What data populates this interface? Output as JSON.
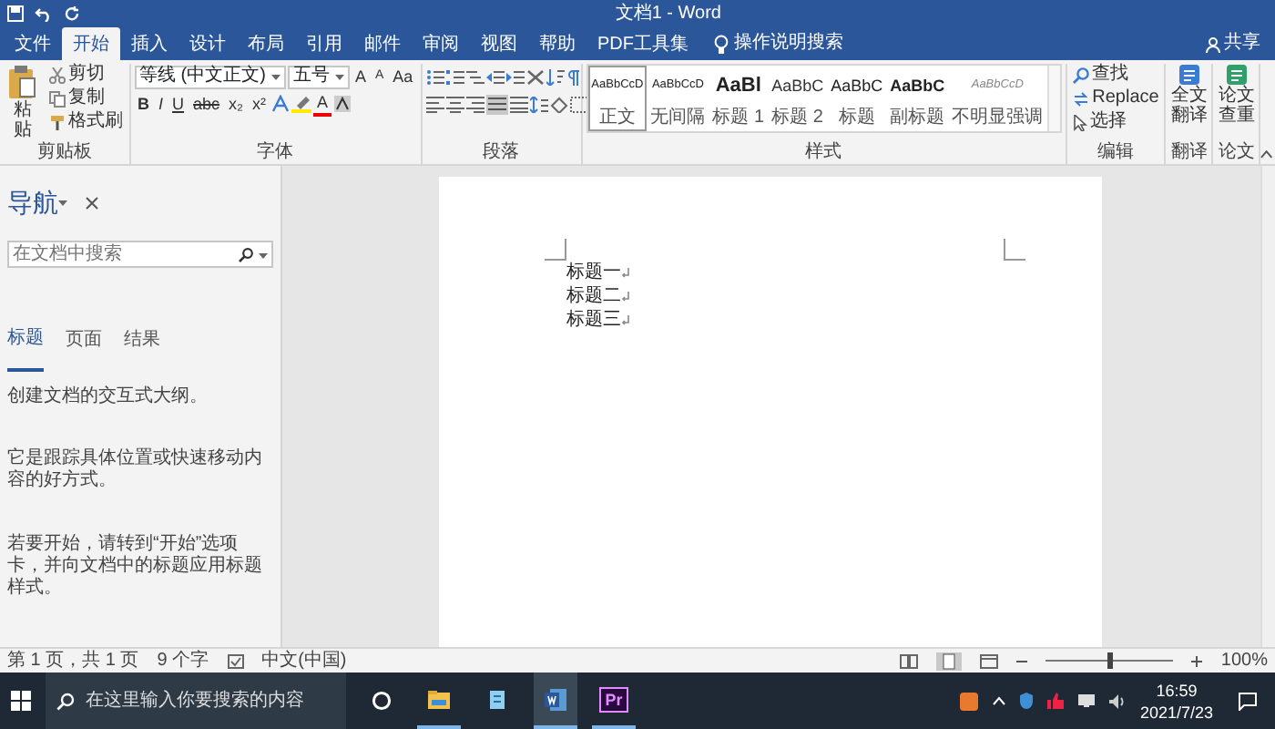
{
  "window": {
    "title": "文档1 - Word"
  },
  "ribbon_tabs": [
    {
      "label": "文件",
      "selected": false
    },
    {
      "label": "开始",
      "selected": true
    },
    {
      "label": "插入",
      "selected": false
    },
    {
      "label": "设计",
      "selected": false
    },
    {
      "label": "布局",
      "selected": false
    },
    {
      "label": "引用",
      "selected": false
    },
    {
      "label": "邮件",
      "selected": false
    },
    {
      "label": "审阅",
      "selected": false
    },
    {
      "label": "视图",
      "selected": false
    },
    {
      "label": "帮助",
      "selected": false
    },
    {
      "label": "PDF工具集",
      "selected": false
    }
  ],
  "tell_me": "操作说明搜索",
  "share": "共享",
  "ribbon": {
    "clipboard": {
      "paste": "粘贴",
      "cut": "剪切",
      "copy": "复制",
      "format_painter": "格式刷",
      "label": "剪贴板"
    },
    "font": {
      "font_name": "等线 (中文正文)",
      "font_size": "五号",
      "size_buttons": [
        "A",
        "A",
        "Aa"
      ],
      "format_buttons": [
        "B",
        "I",
        "U",
        "abc",
        "x₂",
        "x²"
      ],
      "font_color": "A",
      "label": "字体"
    },
    "paragraph": {
      "label": "段落"
    },
    "styles": {
      "items": [
        {
          "sample": "AaBbCcD",
          "name": "正文",
          "kind": "normal",
          "selected": true
        },
        {
          "sample": "AaBbCcD",
          "name": "无间隔",
          "kind": "normal",
          "selected": false
        },
        {
          "sample": "AaBl",
          "name": "标题 1",
          "kind": "heading1",
          "selected": false
        },
        {
          "sample": "AaBbC",
          "name": "标题 2",
          "kind": "heading2",
          "selected": false
        },
        {
          "sample": "AaBbC",
          "name": "标题",
          "kind": "title",
          "selected": false
        },
        {
          "sample": "AaBbC",
          "name": "副标题",
          "kind": "subtitle",
          "selected": false
        },
        {
          "sample": "AaBbCcD",
          "name": "不明显强调",
          "kind": "emphasis",
          "selected": false
        }
      ],
      "label": "样式"
    },
    "editing": {
      "find": "查找",
      "replace": "Replace",
      "select": "选择",
      "label": "编辑"
    },
    "translate": {
      "button": "全文翻译",
      "label": "翻译"
    },
    "plagiarism": {
      "button": "论文查重",
      "label": "论文"
    }
  },
  "navigation": {
    "title": "导航",
    "search_placeholder": "在文档中搜索",
    "tabs": [
      {
        "label": "标题",
        "selected": true
      },
      {
        "label": "页面",
        "selected": false
      },
      {
        "label": "结果",
        "selected": false
      }
    ],
    "messages": [
      "创建文档的交互式大纲。",
      "它是跟踪具体位置或快速移动内容的好方式。",
      "若要开始，请转到“开始”选项卡，并向文档中的标题应用标题样式。"
    ]
  },
  "document": {
    "paragraphs": [
      "标题一",
      "标题二",
      "标题三"
    ]
  },
  "status_bar": {
    "page": "第 1 页，共 1 页",
    "words": "9 个字",
    "language": "中文(中国)",
    "zoom": "100%",
    "zoom_slider": {
      "level": 0.5
    }
  },
  "taskbar": {
    "search_placeholder": "在这里输入你要搜索的内容",
    "apps": [
      {
        "kind": "explorer",
        "open": true,
        "selected": false
      },
      {
        "kind": "notes",
        "open": false,
        "selected": false
      },
      {
        "kind": "word",
        "open": true,
        "selected": true
      },
      {
        "kind": "premiere",
        "label": "Pr",
        "open": true,
        "selected": false
      }
    ],
    "time": "16:59",
    "date": "2021/7/23"
  }
}
